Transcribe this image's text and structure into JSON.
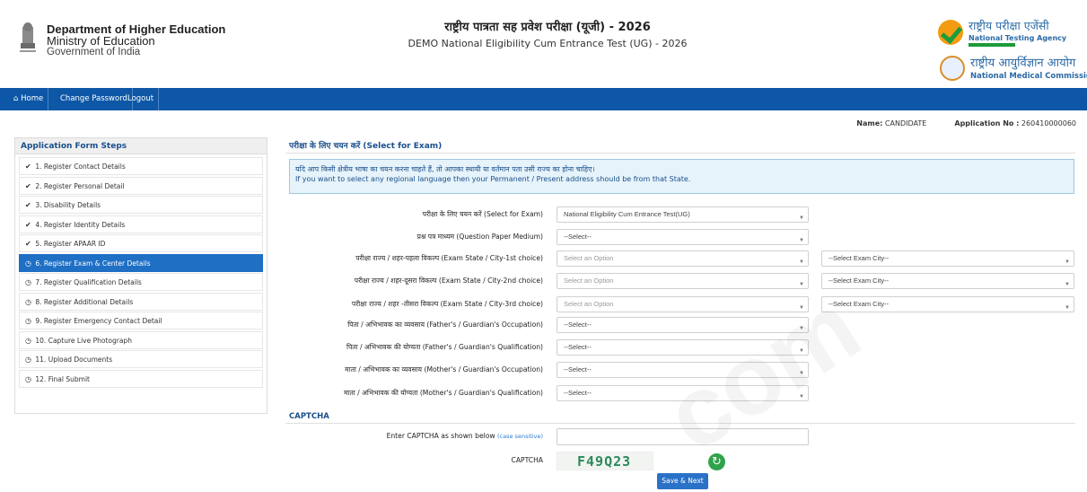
{
  "header": {
    "dept_line1": "Department of Higher Education",
    "dept_line2": "Ministry of Education",
    "dept_line3": "Government of India",
    "title_hi": "राष्ट्रीय पात्रता सह प्रवेश परीक्षा (यूजी) - 2026",
    "title_en": "DEMO National Eligibility Cum Entrance Test (UG) - 2026",
    "nta_hi": "राष्ट्रीय परीक्षा एजेंसी",
    "nta_en": "National Testing Agency",
    "nmc_hi": "राष्ट्रीय आयुर्विज्ञान आयोग",
    "nmc_en": "National Medical Commission"
  },
  "nav": {
    "home": "Home",
    "change_password": "Change Password",
    "logout": "Logout"
  },
  "user": {
    "name_label": "Name:",
    "name_value": "CANDIDATE",
    "app_label": "Application No :",
    "app_value": "260410000060"
  },
  "sidebar": {
    "title": "Application Form Steps",
    "items": [
      {
        "label": "1. Register Contact Details",
        "status": "done"
      },
      {
        "label": "2. Register Personal Detail",
        "status": "done"
      },
      {
        "label": "3. Disability Details",
        "status": "done"
      },
      {
        "label": "4. Register Identity Details",
        "status": "done"
      },
      {
        "label": "5. Register APAAR ID",
        "status": "done"
      },
      {
        "label": "6. Register Exam & Center Details",
        "status": "active"
      },
      {
        "label": "7. Register Qualification Details",
        "status": "pending"
      },
      {
        "label": "8. Register Additional Details",
        "status": "pending"
      },
      {
        "label": "9. Register Emergency Contact Detail",
        "status": "pending"
      },
      {
        "label": "10. Capture Live Photograph",
        "status": "pending"
      },
      {
        "label": "11. Upload Documents",
        "status": "pending"
      },
      {
        "label": "12. Final Submit",
        "status": "pending"
      }
    ]
  },
  "main": {
    "title": "परीक्षा के लिए चयन करें (Select for Exam)",
    "notice_hi": "यदि आप किसी क्षेत्रीय भाषा का चयन करना चाहते हैं, तो आपका स्थायी या वर्तमान पता उसी राज्य का होना चाहिए।",
    "notice_en": "If you want to select any regional language then your Permanent / Present address should be from that State.",
    "rows": [
      {
        "label": "परीक्षा के लिए चयन करें (Select for Exam)",
        "value": "National Eligibility Cum Entrance Test(UG)"
      },
      {
        "label": "प्रश्न पत्र माध्यम (Question Paper Medium)",
        "value": "--Select--"
      },
      {
        "label": "परीक्षा राज्य / शहर-पहला विकल्प (Exam State / City-1st choice)",
        "value": "Select an Option",
        "city": "--Select Exam City--"
      },
      {
        "label": "परीक्षा राज्य / शहर-दूसरा विकल्प (Exam State / City-2nd choice)",
        "value": "Select an Option",
        "city": "--Select Exam City--"
      },
      {
        "label": "परीक्षा राज्य / शहर -तीसरा विकल्प (Exam State / City-3rd choice)",
        "value": "Select an Option",
        "city": "--Select Exam City--"
      },
      {
        "label": "पिता / अभिभावक का व्यवसाय (Father's / Guardian's Occupation)",
        "value": "--Select--"
      },
      {
        "label": "पिता / अभिभावक की योग्यता (Father's / Guardian's Qualification)",
        "value": "--Select--"
      },
      {
        "label": "माता / अभिभावक का व्यवसाय (Mother's / Guardian's Occupation)",
        "value": "--Select--"
      },
      {
        "label": "माता / अभिभावक की योग्यता (Mother's / Guardian's Qualification)",
        "value": "--Select--"
      }
    ]
  },
  "captcha": {
    "heading": "CAPTCHA",
    "enter_label": "Enter CAPTCHA as shown below",
    "case_note": "(case sensitive)",
    "captcha_label": "CAPTCHA",
    "captcha_text": "F49Q23",
    "input_value": "",
    "submit_label": "Save & Next"
  },
  "watermark": "com",
  "colors": {
    "nav_bg": "#0e57a6",
    "active_step": "#1f6fc5",
    "heading": "#1a4f8c"
  }
}
